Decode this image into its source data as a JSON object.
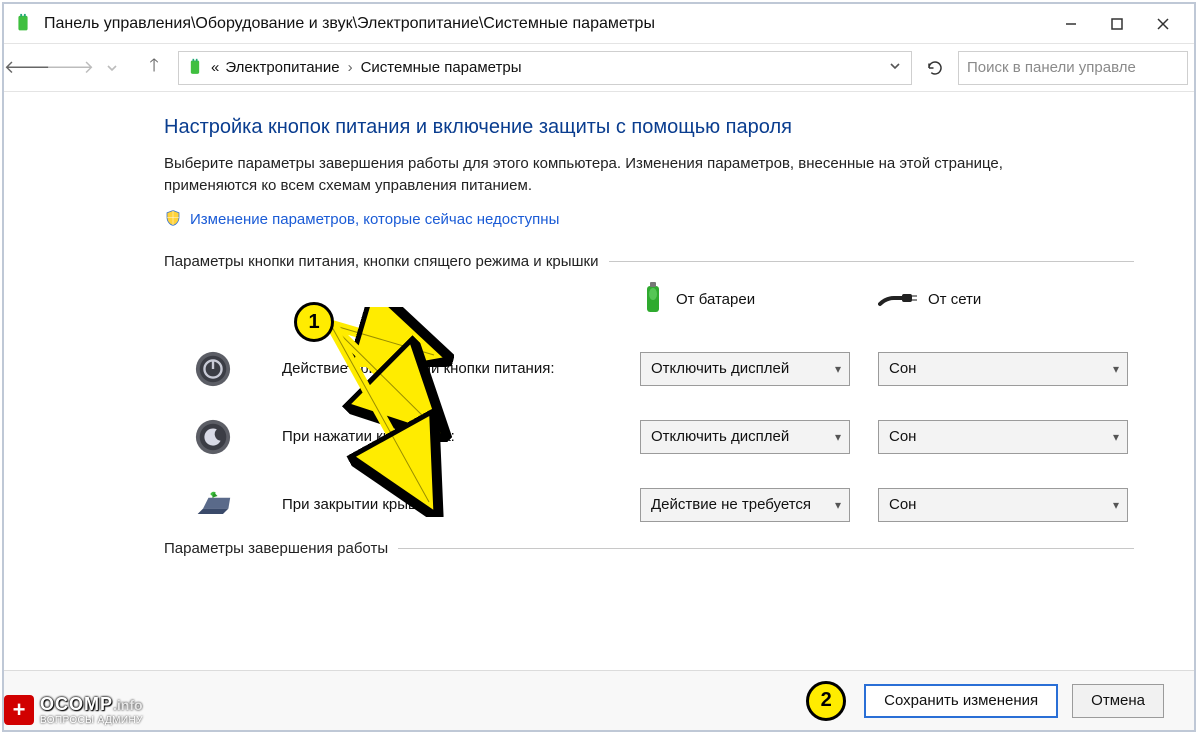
{
  "titlebar": {
    "path": "Панель управления\\Оборудование и звук\\Электропитание\\Системные параметры"
  },
  "breadcrumb": {
    "prefix": "«",
    "item1": "Электропитание",
    "item2": "Системные параметры"
  },
  "search": {
    "placeholder": "Поиск в панели управле"
  },
  "page": {
    "heading": "Настройка кнопок питания и включение защиты с помощью пароля",
    "description": "Выберите параметры завершения работы для этого компьютера. Изменения параметров, внесенные на этой странице, применяются ко всем схемам управления питанием.",
    "shield_link": "Изменение параметров, которые сейчас недоступны",
    "section1": "Параметры кнопки питания, кнопки спящего режима и крышки",
    "section2": "Параметры завершения работы",
    "col_battery": "От батареи",
    "col_plugged": "От сети",
    "rows": [
      {
        "label": "Действие при нажатии кнопки питания:",
        "battery": "Отключить дисплей",
        "plugged": "Сон"
      },
      {
        "label": "При нажатии кнопки сна:",
        "battery": "Отключить дисплей",
        "plugged": "Сон"
      },
      {
        "label": "При закрытии крышки:",
        "battery": "Действие не требуется",
        "plugged": "Сон"
      }
    ]
  },
  "buttons": {
    "save": "Сохранить изменения",
    "cancel": "Отмена"
  },
  "annotations": {
    "m1": "1",
    "m2": "2"
  },
  "watermark": {
    "brand": "OCOMP",
    "tld": ".info",
    "subtitle": "ВОПРОСЫ АДМИНУ"
  }
}
